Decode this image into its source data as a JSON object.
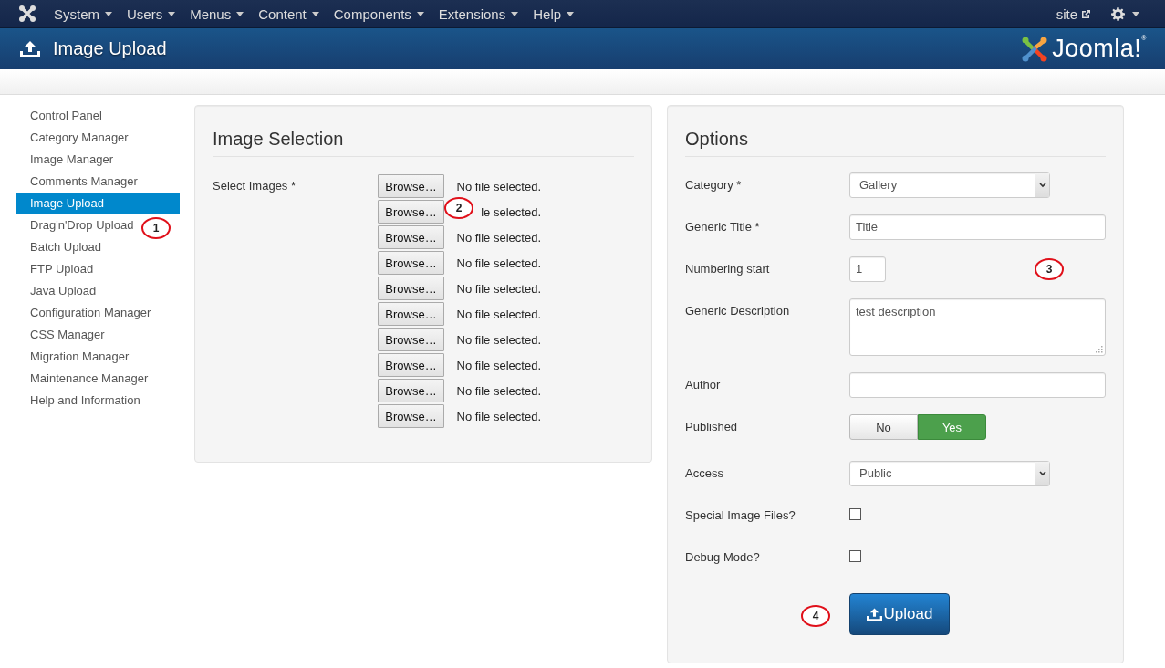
{
  "topbar": {
    "menus": [
      {
        "label": "System"
      },
      {
        "label": "Users"
      },
      {
        "label": "Menus"
      },
      {
        "label": "Content"
      },
      {
        "label": "Components"
      },
      {
        "label": "Extensions"
      },
      {
        "label": "Help"
      }
    ],
    "site_link": "site"
  },
  "header": {
    "title": "Image Upload",
    "logo_text": "Joomla!$^{®}$"
  },
  "sidebar": {
    "items": [
      {
        "label": "Control Panel",
        "selected": false
      },
      {
        "label": "Category Manager",
        "selected": false
      },
      {
        "label": "Image Manager",
        "selected": false
      },
      {
        "label": "Comments Manager",
        "selected": false
      },
      {
        "label": "Image Upload",
        "selected": true
      },
      {
        "label": "Drag'n'Drop Upload",
        "selected": false
      },
      {
        "label": "Batch Upload",
        "selected": false
      },
      {
        "label": "FTP Upload",
        "selected": false
      },
      {
        "label": "Java Upload",
        "selected": false
      },
      {
        "label": "Configuration Manager",
        "selected": false
      },
      {
        "label": "CSS Manager",
        "selected": false
      },
      {
        "label": "Migration Manager",
        "selected": false
      },
      {
        "label": "Maintenance Manager",
        "selected": false
      },
      {
        "label": "Help and Information",
        "selected": false
      }
    ]
  },
  "image_selection": {
    "title": "Image Selection",
    "label": "Select Images *",
    "files": [
      {
        "button": "Browse…",
        "status": "No file selected."
      },
      {
        "button": "Browse…",
        "status": "le selected."
      },
      {
        "button": "Browse…",
        "status": "No file selected."
      },
      {
        "button": "Browse…",
        "status": "No file selected."
      },
      {
        "button": "Browse…",
        "status": "No file selected."
      },
      {
        "button": "Browse…",
        "status": "No file selected."
      },
      {
        "button": "Browse…",
        "status": "No file selected."
      },
      {
        "button": "Browse…",
        "status": "No file selected."
      },
      {
        "button": "Browse…",
        "status": "No file selected."
      },
      {
        "button": "Browse…",
        "status": "No file selected."
      }
    ]
  },
  "options": {
    "title": "Options",
    "fields": [
      {
        "kind": "select",
        "label": "Category *",
        "value": "Gallery"
      },
      {
        "kind": "text",
        "label": "Generic Title *",
        "value": "Title"
      },
      {
        "kind": "number",
        "label": "Numbering start",
        "value": "1"
      },
      {
        "kind": "textarea",
        "label": "Generic Description",
        "value": "test description"
      },
      {
        "kind": "text",
        "label": "Author"
      },
      {
        "kind": "toggle",
        "label": "Published",
        "options": [
          {
            "label": "No",
            "selected": false
          },
          {
            "label": "Yes",
            "selected": true
          }
        ]
      },
      {
        "kind": "select",
        "label": "Access",
        "value": "Public"
      },
      {
        "kind": "checkbox",
        "label": "Special Image Files?",
        "checked": false
      },
      {
        "kind": "checkbox",
        "label": "Debug Mode?",
        "checked": false
      }
    ],
    "submit": "Upload"
  },
  "callouts": [
    {
      "number": "1"
    },
    {
      "number": "2"
    },
    {
      "number": "3"
    },
    {
      "number": "4"
    }
  ]
}
